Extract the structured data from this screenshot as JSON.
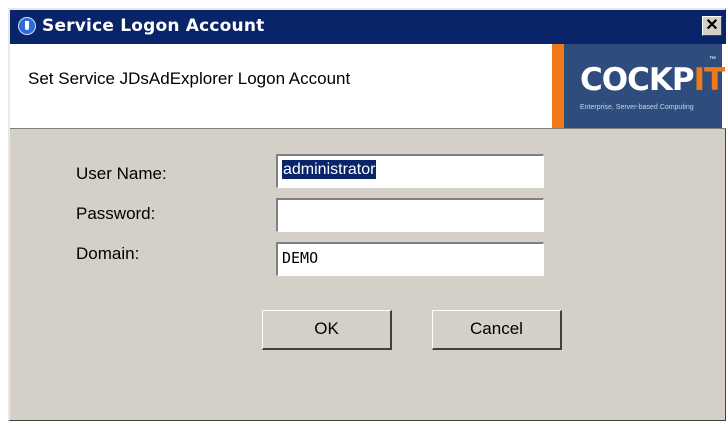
{
  "window": {
    "title": "Service Logon Account",
    "close_label": "✕"
  },
  "header": {
    "text": "Set Service JDsAdExplorer Logon Account"
  },
  "logo": {
    "word_main": "COCKP",
    "word_accent": "IT",
    "tm": "™",
    "tagline": "Enterprise, Server-based Computing"
  },
  "form": {
    "user_name_label": "User Name:",
    "user_name_value": "administrator",
    "password_label": "Password:",
    "password_value": "",
    "domain_label": "Domain:",
    "domain_value": "DEMO"
  },
  "buttons": {
    "ok_label": "OK",
    "cancel_label": "Cancel"
  },
  "colors": {
    "titlebar": "#0a246a",
    "dialog_bg": "#d4d0c8",
    "logo_bg": "#2f4d7c",
    "logo_accent": "#f07a1a",
    "selection": "#0a246a"
  },
  "icons": {
    "title_icon": "service-icon",
    "close_icon": "close-icon"
  }
}
